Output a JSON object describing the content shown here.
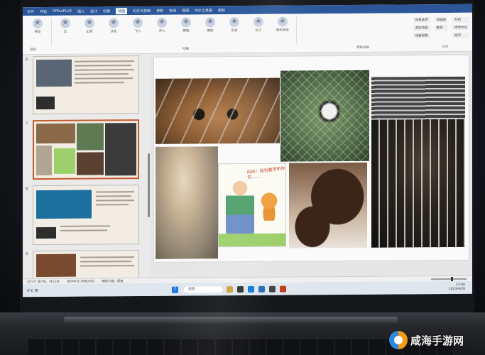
{
  "window": {
    "menu": [
      "文件",
      "开始",
      "OfficePLUS",
      "插入",
      "设计",
      "切换",
      "动画",
      "幻灯片放映",
      "录制",
      "审阅",
      "视图",
      "PDF工具箱",
      "帮助"
    ],
    "active_menu": "动画"
  },
  "ribbon": {
    "preview_label": "预览",
    "effects": [
      "无",
      "出现",
      "淡化",
      "飞入",
      "浮入",
      "劈裂",
      "擦除",
      "形状",
      "轮子",
      "随机线条"
    ],
    "options": [
      "效果选项",
      "添加动画",
      "动画窗格",
      "动画刷",
      "触发",
      "开始",
      "持续时间",
      "延迟"
    ],
    "groups": [
      "预览",
      "动画",
      "高级动画",
      "计时"
    ]
  },
  "thumbnails": [
    {
      "number": "6",
      "selected": false
    },
    {
      "number": "7",
      "selected": true
    },
    {
      "number": "8",
      "selected": false
    },
    {
      "number": "9",
      "selected": false
    }
  ],
  "slide": {
    "cartoon_caption": "呜呜！我也要学听你的……"
  },
  "statusbar": {
    "slide_info": "幻灯片 第7张，共12张",
    "language": "简体中文(中国大陆)",
    "accessibility": "辅助功能: 调查"
  },
  "taskbar": {
    "weather": "9°C 阴",
    "search_placeholder": "搜索",
    "time": "22:40",
    "date": "2023/4/28"
  },
  "watermark": {
    "text": "咸海手游网"
  }
}
